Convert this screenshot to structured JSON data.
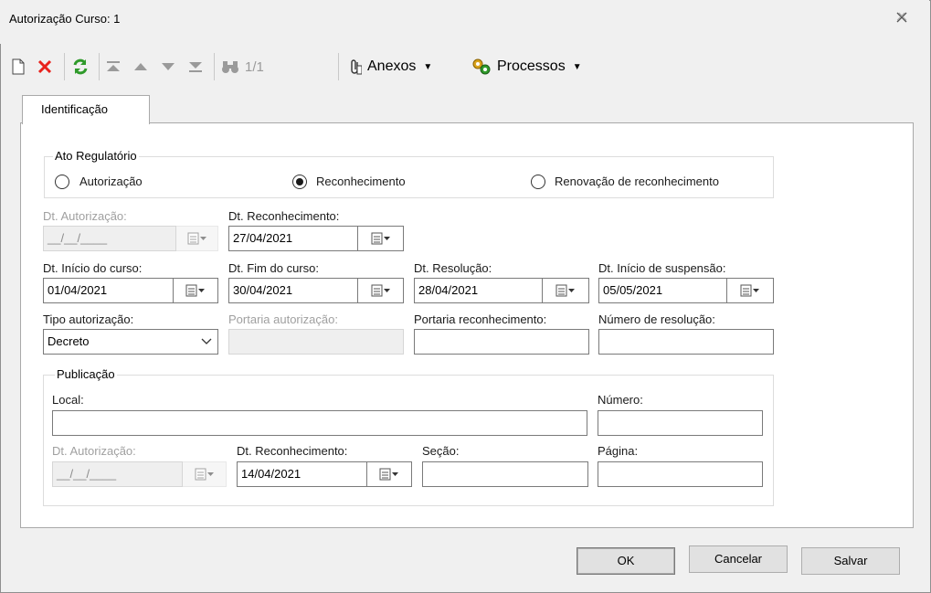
{
  "window": {
    "title": "Autorização Curso: 1"
  },
  "toolbar": {
    "record_counter": "1/1",
    "anexos_label": "Anexos",
    "processos_label": "Processos"
  },
  "tabs": [
    {
      "label": "Identificação"
    }
  ],
  "ato_regulatorio": {
    "legend": "Ato Regulatório",
    "options": [
      "Autorização",
      "Reconhecimento",
      "Renovação de reconhecimento"
    ],
    "selected": "Reconhecimento"
  },
  "fields": {
    "dt_autorizacao": {
      "label": "Dt. Autorização:",
      "value": "__/__/____"
    },
    "dt_reconhecimento": {
      "label": "Dt. Reconhecimento:",
      "value": "27/04/2021"
    },
    "dt_inicio_curso": {
      "label": "Dt. Início do curso:",
      "value": "01/04/2021"
    },
    "dt_fim_curso": {
      "label": "Dt. Fim do curso:",
      "value": "30/04/2021"
    },
    "dt_resolucao": {
      "label": "Dt. Resolução:",
      "value": "28/04/2021"
    },
    "dt_inicio_suspensao": {
      "label": "Dt. Início de suspensão:",
      "value": "05/05/2021"
    },
    "tipo_autorizacao": {
      "label": "Tipo autorização:",
      "value": "Decreto"
    },
    "portaria_autorizacao": {
      "label": "Portaria autorização:",
      "value": ""
    },
    "portaria_reconhecimento": {
      "label": "Portaria reconhecimento:",
      "value": ""
    },
    "numero_resolucao": {
      "label": "Número de resolução:",
      "value": ""
    }
  },
  "publicacao": {
    "legend": "Publicação",
    "local": {
      "label": "Local:",
      "value": ""
    },
    "numero": {
      "label": "Número:",
      "value": ""
    },
    "dt_autorizacao": {
      "label": "Dt. Autorização:",
      "value": "__/__/____"
    },
    "dt_reconhecimento": {
      "label": "Dt. Reconhecimento:",
      "value": "14/04/2021"
    },
    "secao": {
      "label": "Seção:",
      "value": ""
    },
    "pagina": {
      "label": "Página:",
      "value": ""
    }
  },
  "buttons": {
    "ok": "OK",
    "cancelar": "Cancelar",
    "salvar": "Salvar"
  },
  "colors": {
    "delete_red": "#e8221c",
    "refresh_green": "#2f9a2a",
    "accent_gold": "#d9a21b"
  }
}
